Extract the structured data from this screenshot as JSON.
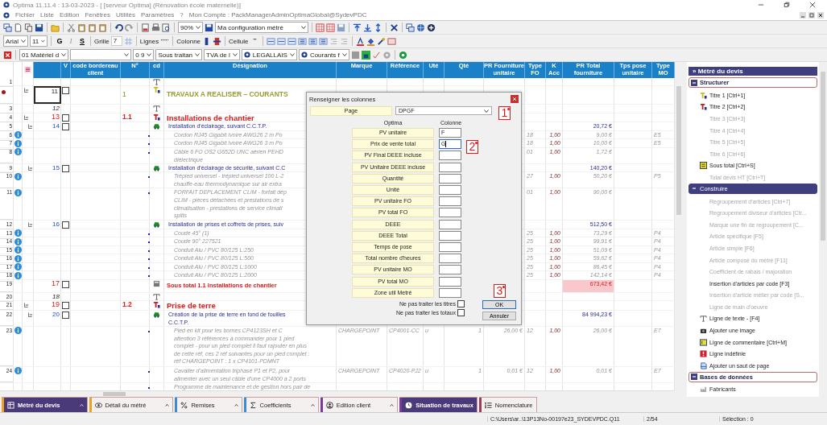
{
  "window": {
    "title": "Optima 11.11.4 : 13-03-2023 - [ [serveur Optima] (Rénovation école maternelle)]"
  },
  "menu": [
    "Fichier",
    "Liste",
    "Edition",
    "Fenêtres",
    "Utilités",
    "Paramètres",
    "?"
  ],
  "account": "Mon Compte : PackManagerAdminOptimaGlobal@SydevPDC",
  "toolbar": {
    "zoom": "90%",
    "config": "Ma configuration métré"
  },
  "format_bar": {
    "font": "Arial",
    "size": "11",
    "bold": "G",
    "italic": "I",
    "strike": "S",
    "grid_label": "Grille",
    "grid_value": "7",
    "lines_label": "Lignes",
    "column_label": "Colonne",
    "cell_label": "Cellule"
  },
  "filter_bar": {
    "dropdowns": [
      {
        "value": "01 Matériel d",
        "kind": "plain"
      },
      {
        "kind": "blank"
      },
      {
        "value": "0 9",
        "kind": "plain"
      },
      {
        "value": "Sous traitan",
        "kind": "plain"
      },
      {
        "value": "TVA de l",
        "kind": "plain"
      },
      {
        "value": "LEGALLAIS",
        "kind": "logo"
      },
      {
        "value": "Courants f",
        "kind": "logo"
      }
    ]
  },
  "table": {
    "columns": [
      "V",
      "code bordereau client",
      "N°",
      "cd",
      "Désignation",
      "Marque",
      "Référence",
      "Uté",
      "Qté",
      "PR Fourniture unitaire",
      "Type FO",
      "K Acc",
      "PR Total fourniture",
      "Tps pose unitaire",
      "Type MO"
    ],
    "rows": [
      {
        "kind": "text",
        "num": "1",
        "current": false,
        "info": false,
        "selected": false
      },
      {
        "kind": "title1",
        "current": true,
        "info": false,
        "selected": true,
        "expanded": true,
        "line": "11",
        "checked": false,
        "n": "1",
        "lines": [
          "TRAVAUX A REALISER – COURANTS"
        ]
      },
      {
        "kind": "text",
        "num": "3",
        "current": false,
        "info": false,
        "selected": false,
        "line": "12"
      },
      {
        "kind": "title2",
        "num": "4",
        "current": false,
        "info": false,
        "selected": false,
        "expanded": true,
        "line": "13",
        "checked": false,
        "n": "1.1",
        "lines": [
          "Installations de chantier"
        ]
      },
      {
        "kind": "group",
        "num": "5",
        "current": false,
        "info": false,
        "selected": false,
        "expanded": true,
        "line": "14",
        "checked": false,
        "lines": [
          "Installation d'éclairage, suivant C.C.T.P."
        ],
        "prtotal": "20,72 €"
      },
      {
        "kind": "item",
        "num": "6",
        "current": false,
        "info": true,
        "selected": false,
        "lines": [
          "Cordon RJ45 Gigabit Ivoire AWG26 2 m Po"
        ],
        "typefo": "18",
        "kacc": "1,00",
        "prtotal": "9,00 €",
        "typemo": "E5"
      },
      {
        "kind": "item",
        "num": "7",
        "current": false,
        "info": true,
        "selected": false,
        "lines": [
          "Cordon RJ45 Gigabit Ivoire AWG26 3 m Po"
        ],
        "typefo": "18",
        "kacc": "1,00",
        "prtotal": "10,00 €",
        "typemo": "E5"
      },
      {
        "kind": "item",
        "num": "8",
        "current": false,
        "info": true,
        "selected": false,
        "lines": [
          "Câble 6 FO OS2 G652D UNC aérien PEHD",
          "diélectrique"
        ],
        "typefo": "01",
        "kacc": "1,00",
        "prtotal": "1,72 €"
      },
      {
        "kind": "group",
        "num": "9",
        "current": false,
        "info": false,
        "selected": false,
        "expanded": true,
        "line": "15",
        "checked": false,
        "lines": [
          "Installation d'éclairage de sécurité, suivant C.C"
        ],
        "prtotal": "140,20 €"
      },
      {
        "kind": "item",
        "num": "10",
        "current": false,
        "info": true,
        "selected": false,
        "lines": [
          "Trépied universel - trépied universel 100 L-2",
          "chauffe-eau thermodynamique sur air extra"
        ],
        "typefo": "27",
        "kacc": "1,00",
        "prtotal": "50,20 €",
        "typemo": "P5"
      },
      {
        "kind": "item",
        "num": "11",
        "current": false,
        "info": true,
        "selected": false,
        "lines": [
          "FORFAIT DEPLACEMENT CLIM - forfait dép",
          "CLIM - pièces détachées et prestations de s",
          "climatisation - prestations de service climati",
          "splits"
        ],
        "typefo": "01",
        "kacc": "1,00",
        "prtotal": "90,00 €"
      },
      {
        "kind": "group",
        "num": "12",
        "current": false,
        "info": false,
        "selected": false,
        "expanded": true,
        "line": "16",
        "checked": false,
        "lines": [
          "Installation de prises et coffrets de prises, suiv"
        ],
        "prtotal": "512,50 €"
      },
      {
        "kind": "item",
        "num": "13",
        "current": false,
        "info": true,
        "selected": false,
        "lines": [
          "Coude 45° (1)"
        ],
        "typefo": "25",
        "kacc": "1,00",
        "prtotal": "73,29 €",
        "typemo": "P4"
      },
      {
        "kind": "item",
        "num": "14",
        "current": false,
        "info": true,
        "selected": false,
        "lines": [
          "Coude 90° 227521"
        ],
        "typefo": "25",
        "kacc": "1,00",
        "prtotal": "99,91 €",
        "typemo": "P4"
      },
      {
        "kind": "item",
        "num": "15",
        "current": false,
        "info": true,
        "selected": false,
        "lines": [
          "Conduit Alu / PVC 80/125 L:250"
        ],
        "typefo": "25",
        "kacc": "1,00",
        "prtotal": "51,09 €",
        "typemo": "P4"
      },
      {
        "kind": "item",
        "num": "16",
        "current": false,
        "info": true,
        "selected": false,
        "lines": [
          "Conduit Alu / PVC 80/125 L:500"
        ],
        "typefo": "25",
        "kacc": "1,00",
        "prtotal": "59,62 €",
        "typemo": "P4"
      },
      {
        "kind": "item",
        "num": "17",
        "current": false,
        "info": true,
        "selected": false,
        "lines": [
          "Conduit Alu / PVC 80/125 L:1000"
        ],
        "typefo": "25",
        "kacc": "1,00",
        "prtotal": "86,45 €",
        "typemo": "P4"
      },
      {
        "kind": "item",
        "num": "18",
        "current": false,
        "info": true,
        "selected": false,
        "lines": [
          "Conduit Alu / PVC 80/125 L:2000"
        ],
        "typefo": "25",
        "kacc": "1,00",
        "prtotal": "142,14 €",
        "typemo": "P4"
      },
      {
        "kind": "subtotal",
        "num": "19",
        "current": false,
        "info": false,
        "selected": false,
        "line": "17",
        "checked": false,
        "lines": [
          "Sous total 1.1 Installations de chantier"
        ],
        "prtotal": "673,42 €"
      },
      {
        "kind": "text",
        "num": "20",
        "current": false,
        "info": false,
        "selected": false,
        "line": "18"
      },
      {
        "kind": "title2",
        "num": "21",
        "current": false,
        "info": false,
        "selected": false,
        "expanded": true,
        "line": "19",
        "checked": false,
        "n": "1.2",
        "lines": [
          "Prise de terre"
        ]
      },
      {
        "kind": "group",
        "num": "22",
        "current": false,
        "info": false,
        "selected": false,
        "expanded": true,
        "line": "20",
        "checked": false,
        "lines": [
          "Création de la prise de terre en fond de fouilles",
          "C.C.T.P."
        ],
        "prtotal": "84 994,23 €"
      },
      {
        "kind": "item",
        "num": "23",
        "current": false,
        "info": true,
        "selected": false,
        "lines": [
          "Pied en kit pour les bornes CP4123SH et C",
          "attention 3 références à commander pour 1 pied",
          "complet - pour un pied complet il faut rajouter en plus",
          "de cette réf, ces 2 réf suivantes pour un pied complet :",
          "réf CHARGEPOINT : 1 x CP4101-PDMNT"
        ],
        "marque": "CHARGEPOINT",
        "ref": "CP4001-CC",
        "ute": "u",
        "qte": "1",
        "prfu": "26,00 €",
        "typefo": "12",
        "kacc": "1,00",
        "prtotal": "26,00 €",
        "typemo": "E7"
      },
      {
        "kind": "item",
        "num": "24",
        "current": false,
        "info": true,
        "selected": false,
        "lines": [
          "Cavalier d'alimentation triphasé P1 et P2, pour",
          "alimenter avec un seul câble d'une CP4000 à 2 ports"
        ],
        "marque": "CHARGEPOINT",
        "ref": "CP4020-PJ2",
        "ute": "u",
        "qte": "1",
        "prfu": "0,01 €",
        "typefo": "12",
        "kacc": "1,00",
        "prtotal": "0,01 €",
        "typemo": "E7"
      },
      {
        "kind": "item",
        "current": false,
        "info": false,
        "selected": false,
        "lines": [
          "Programme de maintenance et de gestion hors pair de"
        ]
      }
    ]
  },
  "dialog": {
    "title": "Renseigner les colonnes",
    "page_label": "Page",
    "page_value": "DPGF",
    "head_optima": "Optima",
    "head_column": "Colonne",
    "fields": [
      {
        "label": "PV unitaire",
        "value": "F",
        "focused": false
      },
      {
        "label": "Prix de vente total",
        "value": "G",
        "focused": true
      },
      {
        "label": "PV Final DEEE incluse",
        "focused": false
      },
      {
        "label": "PV Unitaire DEEE incluse",
        "focused": false
      },
      {
        "label": "Quantité",
        "focused": false
      },
      {
        "label": "Unité",
        "focused": false
      },
      {
        "label": "PV unitaire FO",
        "focused": false
      },
      {
        "label": "PV total FO",
        "focused": false
      },
      {
        "label": "DEEE",
        "focused": false
      },
      {
        "label": "DEEE Total",
        "focused": false
      },
      {
        "label": "Temps de pose",
        "focused": false
      },
      {
        "label": "Total nombre d'heures",
        "focused": false
      },
      {
        "label": "PV unitaire MO",
        "focused": false
      },
      {
        "label": "PV total MO",
        "focused": false
      },
      {
        "label": "Zone util Metré",
        "focused": false
      }
    ],
    "options": [
      {
        "label": "Ne pas traiter les titres",
        "checked": false
      },
      {
        "label": "Ne pas traiter les totaux",
        "checked": false
      }
    ],
    "buttons": [
      "OK",
      "Annuler"
    ],
    "markers": [
      "1",
      "2",
      "3"
    ]
  },
  "panel": {
    "expander": "»",
    "title": "Métré du devis",
    "sections": [
      {
        "title": "Structurer",
        "selected": false,
        "expanded": true,
        "items": [
          {
            "label": "Titre 1 [Ctrl+1]",
            "kind": "title1",
            "disabled": false
          },
          {
            "label": "Titre 2 [Ctrl+2]",
            "kind": "title2",
            "disabled": false
          },
          {
            "label": "Titre 3 [Ctrl+3]",
            "kind": "none",
            "disabled": true
          },
          {
            "label": "Titre 4 [Ctrl+4]",
            "kind": "none",
            "disabled": true
          },
          {
            "label": "Titre 5 [Ctrl+5]",
            "kind": "none",
            "disabled": true
          },
          {
            "label": "Titre 6 [Ctrl+6]",
            "kind": "none",
            "disabled": true
          },
          {
            "label": "Sous total [Ctrl+S]",
            "kind": "subtotal",
            "disabled": false
          },
          {
            "label": "Total devis HT [Ctrl+T]",
            "kind": "none",
            "disabled": true
          }
        ]
      },
      {
        "title": "Construire",
        "selected": true,
        "expanded": true,
        "items": [
          {
            "label": "Regroupement d'articles  [Ctrl+7]",
            "kind": "none",
            "disabled": true
          },
          {
            "label": "Regroupement diviseur d'articles [Ctr...",
            "kind": "none",
            "disabled": true
          },
          {
            "label": "Marque une fin de regroupement  [C...",
            "kind": "none",
            "disabled": true
          },
          {
            "label": "Article spécifique [F5]",
            "kind": "none",
            "disabled": true
          },
          {
            "label": "Article simple [F6]",
            "kind": "none",
            "disabled": true
          },
          {
            "label": "Article composé du métré [F11]",
            "kind": "none",
            "disabled": true
          },
          {
            "label": "Coefficient de rabais / majoration",
            "kind": "none",
            "disabled": true
          },
          {
            "label": "Insertion d'articles par code [F3]",
            "kind": "none",
            "disabled": false
          },
          {
            "label": "Insertion d'article métier par code [S...",
            "kind": "none",
            "disabled": true
          },
          {
            "label": "Ligne de main d'oeuvre",
            "kind": "none",
            "disabled": true
          },
          {
            "label": "Ligne de texte - [F4]",
            "kind": "text",
            "disabled": false
          },
          {
            "label": "Ajouter une image",
            "kind": "camera",
            "disabled": false
          },
          {
            "label": "Ligne de commentaire [Ctrl+M]",
            "kind": "comment",
            "disabled": false
          },
          {
            "label": "Ligne indéfinie",
            "kind": "undefined",
            "disabled": false
          },
          {
            "label": "Ajouter un saut de page",
            "kind": "pagebreak",
            "disabled": false
          }
        ]
      },
      {
        "title": "Bases de données",
        "selected": false,
        "expanded": true,
        "items": [
          {
            "label": "Fabricants",
            "kind": "factory",
            "disabled": false
          }
        ]
      }
    ]
  },
  "bottom_tabs": [
    {
      "label": "Métré du devis",
      "selected": true,
      "color": "#f0a020"
    },
    {
      "label": "Détail du métré",
      "selected": false,
      "color": "#f0a020"
    },
    {
      "label": "Remises",
      "selected": false,
      "color": "#3a8ad8"
    },
    {
      "label": "Coefficients",
      "selected": false,
      "color": "#3a8ad8"
    },
    {
      "label": "Edition client",
      "selected": false,
      "color": "#7a3a9a"
    },
    {
      "label": "Situation de travaux",
      "selected": true,
      "color": "#7a3a9a"
    },
    {
      "label": "Nomenclature",
      "selected": false,
      "color": "#9a3a5a"
    }
  ],
  "status_bar": {
    "path": "C:\\Users\\ar..\\13P13No-00197e23_SYDEVPDC.Q11",
    "page": "2/54",
    "selection": "Sélection : 0"
  }
}
